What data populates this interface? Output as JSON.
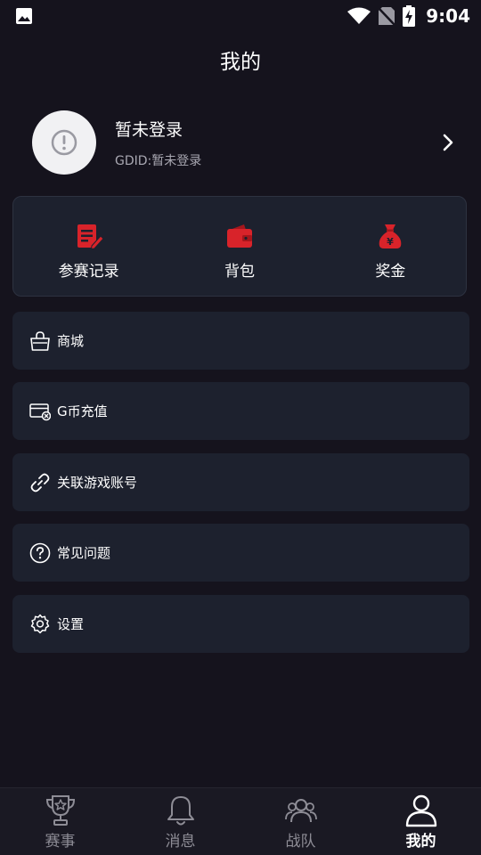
{
  "status_bar": {
    "time": "9:04"
  },
  "page": {
    "title": "我的"
  },
  "profile": {
    "name": "暂未登录",
    "id_text": "GDID:暂未登录"
  },
  "quick_actions": [
    {
      "label": "参赛记录",
      "icon": "clipboard-edit-icon"
    },
    {
      "label": "背包",
      "icon": "wallet-icon"
    },
    {
      "label": "奖金",
      "icon": "money-bag-icon"
    }
  ],
  "menu": [
    {
      "label": "商城",
      "icon": "shopping-bag-icon"
    },
    {
      "label": "G币充值",
      "icon": "recharge-card-icon"
    },
    {
      "label": "关联游戏账号",
      "icon": "link-icon"
    },
    {
      "label": "常见问题",
      "icon": "question-circle-icon"
    },
    {
      "label": "设置",
      "icon": "gear-icon"
    }
  ],
  "tabs": [
    {
      "label": "赛事",
      "icon": "trophy-icon",
      "active": false
    },
    {
      "label": "消息",
      "icon": "bell-icon",
      "active": false
    },
    {
      "label": "战队",
      "icon": "team-icon",
      "active": false
    },
    {
      "label": "我的",
      "icon": "user-icon",
      "active": true
    }
  ],
  "colors": {
    "background": "#15131d",
    "card": "#1d212e",
    "accent_red": "#d8232a",
    "tab_inactive": "#8e8d96",
    "tab_active": "#ffffff"
  }
}
